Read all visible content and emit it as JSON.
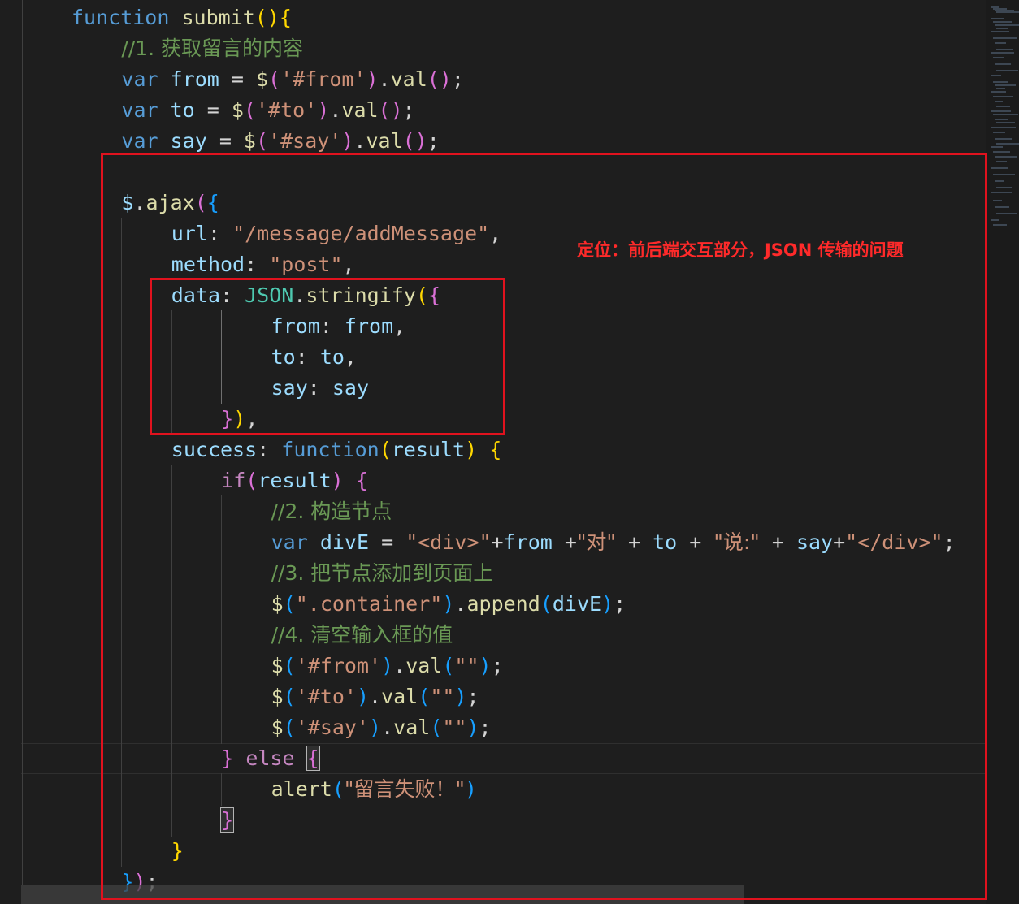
{
  "annotation": {
    "text": "定位：前后端交互部分，JSON 传输的问题",
    "color": "#e0121e"
  },
  "theme": {
    "background": "#1e1e1e",
    "keyword": "#569cd6",
    "control": "#c586c0",
    "variable": "#9cdcfe",
    "function": "#dcdcaa",
    "string": "#ce9178",
    "comment": "#6a9955"
  },
  "code": [
    {
      "indent": 1,
      "tokens": [
        [
          "kw",
          "function"
        ],
        [
          "op",
          " "
        ],
        [
          "fn",
          "submit"
        ],
        [
          "p1",
          "()"
        ],
        [
          "p1",
          "{"
        ]
      ]
    },
    {
      "indent": 2,
      "tokens": [
        [
          "cmt",
          "//1. 获取留言的内容"
        ]
      ]
    },
    {
      "indent": 2,
      "tokens": [
        [
          "kw",
          "var"
        ],
        [
          "op",
          " "
        ],
        [
          "var",
          "from"
        ],
        [
          "op",
          " = "
        ],
        [
          "fn",
          "$"
        ],
        [
          "p2",
          "("
        ],
        [
          "str",
          "'#from'"
        ],
        [
          "p2",
          ")"
        ],
        [
          "op",
          "."
        ],
        [
          "fn",
          "val"
        ],
        [
          "p2",
          "()"
        ],
        [
          "op",
          ";"
        ]
      ]
    },
    {
      "indent": 2,
      "tokens": [
        [
          "kw",
          "var"
        ],
        [
          "op",
          " "
        ],
        [
          "var",
          "to"
        ],
        [
          "op",
          " = "
        ],
        [
          "fn",
          "$"
        ],
        [
          "p2",
          "("
        ],
        [
          "str",
          "'#to'"
        ],
        [
          "p2",
          ")"
        ],
        [
          "op",
          "."
        ],
        [
          "fn",
          "val"
        ],
        [
          "p2",
          "()"
        ],
        [
          "op",
          ";"
        ]
      ]
    },
    {
      "indent": 2,
      "tokens": [
        [
          "kw",
          "var"
        ],
        [
          "op",
          " "
        ],
        [
          "var",
          "say"
        ],
        [
          "op",
          " = "
        ],
        [
          "fn",
          "$"
        ],
        [
          "p2",
          "("
        ],
        [
          "str",
          "'#say'"
        ],
        [
          "p2",
          ")"
        ],
        [
          "op",
          "."
        ],
        [
          "fn",
          "val"
        ],
        [
          "p2",
          "()"
        ],
        [
          "op",
          ";"
        ]
      ]
    },
    {
      "indent": 0,
      "tokens": []
    },
    {
      "indent": 2,
      "tokens": [
        [
          "var",
          "$"
        ],
        [
          "op",
          "."
        ],
        [
          "fn",
          "ajax"
        ],
        [
          "p2",
          "("
        ],
        [
          "p3",
          "{"
        ]
      ]
    },
    {
      "indent": 3,
      "tokens": [
        [
          "var",
          "url"
        ],
        [
          "op",
          ": "
        ],
        [
          "str",
          "\"/message/addMessage\""
        ],
        [
          "op",
          ","
        ]
      ]
    },
    {
      "indent": 3,
      "tokens": [
        [
          "var",
          "method"
        ],
        [
          "op",
          ": "
        ],
        [
          "str",
          "\"post\""
        ],
        [
          "op",
          ","
        ]
      ]
    },
    {
      "indent": 3,
      "tokens": [
        [
          "var",
          "data"
        ],
        [
          "op",
          ": "
        ],
        [
          "obj",
          "JSON"
        ],
        [
          "op",
          "."
        ],
        [
          "fn",
          "stringify"
        ],
        [
          "p1",
          "("
        ],
        [
          "p2",
          "{"
        ]
      ]
    },
    {
      "indent": 5,
      "tokens": [
        [
          "var",
          "from"
        ],
        [
          "op",
          ": "
        ],
        [
          "var",
          "from"
        ],
        [
          "op",
          ","
        ]
      ]
    },
    {
      "indent": 5,
      "tokens": [
        [
          "var",
          "to"
        ],
        [
          "op",
          ": "
        ],
        [
          "var",
          "to"
        ],
        [
          "op",
          ","
        ]
      ]
    },
    {
      "indent": 5,
      "tokens": [
        [
          "var",
          "say"
        ],
        [
          "op",
          ": "
        ],
        [
          "var",
          "say"
        ]
      ]
    },
    {
      "indent": 4,
      "tokens": [
        [
          "p2",
          "}"
        ],
        [
          "p1",
          ")"
        ],
        [
          "op",
          ","
        ]
      ]
    },
    {
      "indent": 3,
      "tokens": [
        [
          "var",
          "success"
        ],
        [
          "op",
          ": "
        ],
        [
          "kw",
          "function"
        ],
        [
          "p1",
          "("
        ],
        [
          "var",
          "result"
        ],
        [
          "p1",
          ")"
        ],
        [
          "op",
          " "
        ],
        [
          "p1",
          "{"
        ]
      ]
    },
    {
      "indent": 4,
      "tokens": [
        [
          "ctl",
          "if"
        ],
        [
          "p2",
          "("
        ],
        [
          "var",
          "result"
        ],
        [
          "p2",
          ")"
        ],
        [
          "op",
          " "
        ],
        [
          "p2",
          "{"
        ]
      ]
    },
    {
      "indent": 5,
      "tokens": [
        [
          "cmt",
          "//2. 构造节点"
        ]
      ]
    },
    {
      "indent": 5,
      "tokens": [
        [
          "kw",
          "var"
        ],
        [
          "op",
          " "
        ],
        [
          "var",
          "divE"
        ],
        [
          "op",
          " = "
        ],
        [
          "str",
          "\"<div>\""
        ],
        [
          "op",
          "+"
        ],
        [
          "var",
          "from"
        ],
        [
          "op",
          " +"
        ],
        [
          "str",
          "\"对\""
        ],
        [
          "op",
          " + "
        ],
        [
          "var",
          "to"
        ],
        [
          "op",
          " + "
        ],
        [
          "str",
          "\"说:\""
        ],
        [
          "op",
          " + "
        ],
        [
          "var",
          "say"
        ],
        [
          "op",
          "+"
        ],
        [
          "str",
          "\"</div>\""
        ],
        [
          "op",
          ";"
        ]
      ]
    },
    {
      "indent": 5,
      "tokens": [
        [
          "cmt",
          "//3. 把节点添加到页面上"
        ]
      ]
    },
    {
      "indent": 5,
      "tokens": [
        [
          "fn",
          "$"
        ],
        [
          "p3",
          "("
        ],
        [
          "str",
          "\".container\""
        ],
        [
          "p3",
          ")"
        ],
        [
          "op",
          "."
        ],
        [
          "fn",
          "append"
        ],
        [
          "p3",
          "("
        ],
        [
          "var",
          "divE"
        ],
        [
          "p3",
          ")"
        ],
        [
          "op",
          ";"
        ]
      ]
    },
    {
      "indent": 5,
      "tokens": [
        [
          "cmt",
          "//4. 清空输入框的值"
        ]
      ]
    },
    {
      "indent": 5,
      "tokens": [
        [
          "fn",
          "$"
        ],
        [
          "p3",
          "("
        ],
        [
          "str",
          "'#from'"
        ],
        [
          "p3",
          ")"
        ],
        [
          "op",
          "."
        ],
        [
          "fn",
          "val"
        ],
        [
          "p3",
          "("
        ],
        [
          "str",
          "\"\""
        ],
        [
          "p3",
          ")"
        ],
        [
          "op",
          ";"
        ]
      ]
    },
    {
      "indent": 5,
      "tokens": [
        [
          "fn",
          "$"
        ],
        [
          "p3",
          "("
        ],
        [
          "str",
          "'#to'"
        ],
        [
          "p3",
          ")"
        ],
        [
          "op",
          "."
        ],
        [
          "fn",
          "val"
        ],
        [
          "p3",
          "("
        ],
        [
          "str",
          "\"\""
        ],
        [
          "p3",
          ")"
        ],
        [
          "op",
          ";"
        ]
      ]
    },
    {
      "indent": 5,
      "tokens": [
        [
          "fn",
          "$"
        ],
        [
          "p3",
          "("
        ],
        [
          "str",
          "'#say'"
        ],
        [
          "p3",
          ")"
        ],
        [
          "op",
          "."
        ],
        [
          "fn",
          "val"
        ],
        [
          "p3",
          "("
        ],
        [
          "str",
          "\"\""
        ],
        [
          "p3",
          ")"
        ],
        [
          "op",
          ";"
        ]
      ]
    },
    {
      "indent": 4,
      "tokens": [
        [
          "p2",
          "}"
        ],
        [
          "op",
          " "
        ],
        [
          "ctl",
          "else"
        ],
        [
          "op",
          " "
        ],
        [
          "p2bm",
          "{"
        ]
      ]
    },
    {
      "indent": 5,
      "tokens": [
        [
          "fn",
          "alert"
        ],
        [
          "p3",
          "("
        ],
        [
          "str",
          "\"留言失败！\""
        ],
        [
          "p3",
          ")"
        ]
      ]
    },
    {
      "indent": 4,
      "tokens": [
        [
          "p2bm",
          "}"
        ]
      ]
    },
    {
      "indent": 3,
      "tokens": [
        [
          "p1",
          "}"
        ]
      ]
    },
    {
      "indent": 2,
      "tokens": [
        [
          "p3",
          "}"
        ],
        [
          "p2",
          ")"
        ],
        [
          "op",
          ";"
        ]
      ]
    }
  ]
}
